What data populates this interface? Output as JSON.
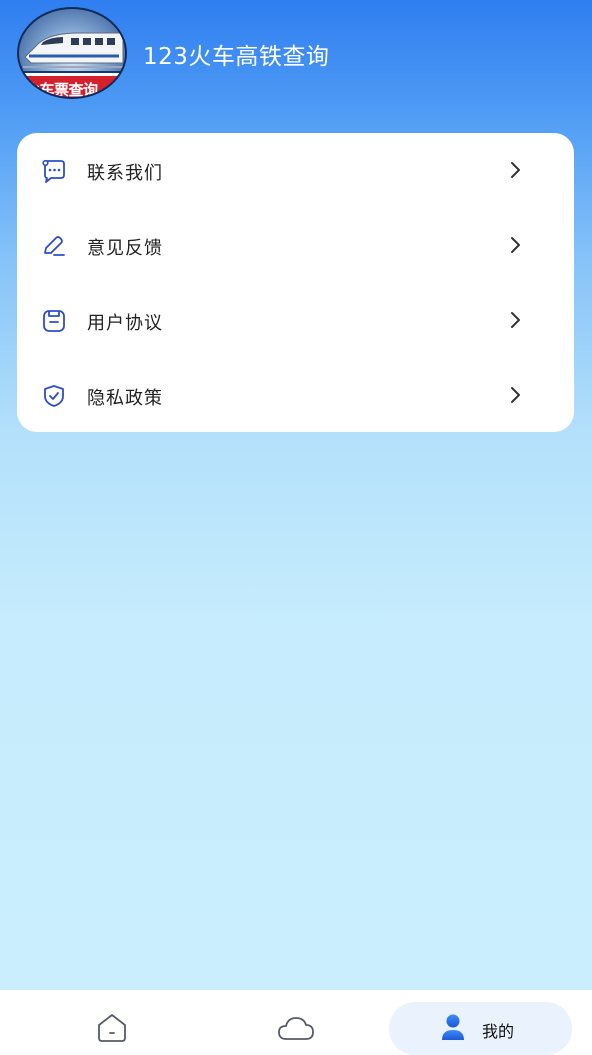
{
  "header": {
    "title": "123火车高铁查询",
    "logo_text": "火车票查询"
  },
  "menu": {
    "items": [
      {
        "label": "联系我们",
        "icon": "chat-bubble-icon"
      },
      {
        "label": "意见反馈",
        "icon": "pencil-icon"
      },
      {
        "label": "用户协议",
        "icon": "document-icon"
      },
      {
        "label": "隐私政策",
        "icon": "shield-check-icon"
      }
    ]
  },
  "tabbar": {
    "tabs": [
      {
        "label": "",
        "icon": "home-icon",
        "active": false
      },
      {
        "label": "",
        "icon": "cloud-icon",
        "active": false
      },
      {
        "label": "我的",
        "icon": "user-icon",
        "active": true
      }
    ]
  },
  "colors": {
    "accent": "#2d4ec8",
    "header_gradient_top": "#2f7ef0",
    "background_bottom": "#cbeffd",
    "card": "#ffffff",
    "tab_active_bg": "#e9f2fd",
    "logo_red": "#d5202e"
  }
}
